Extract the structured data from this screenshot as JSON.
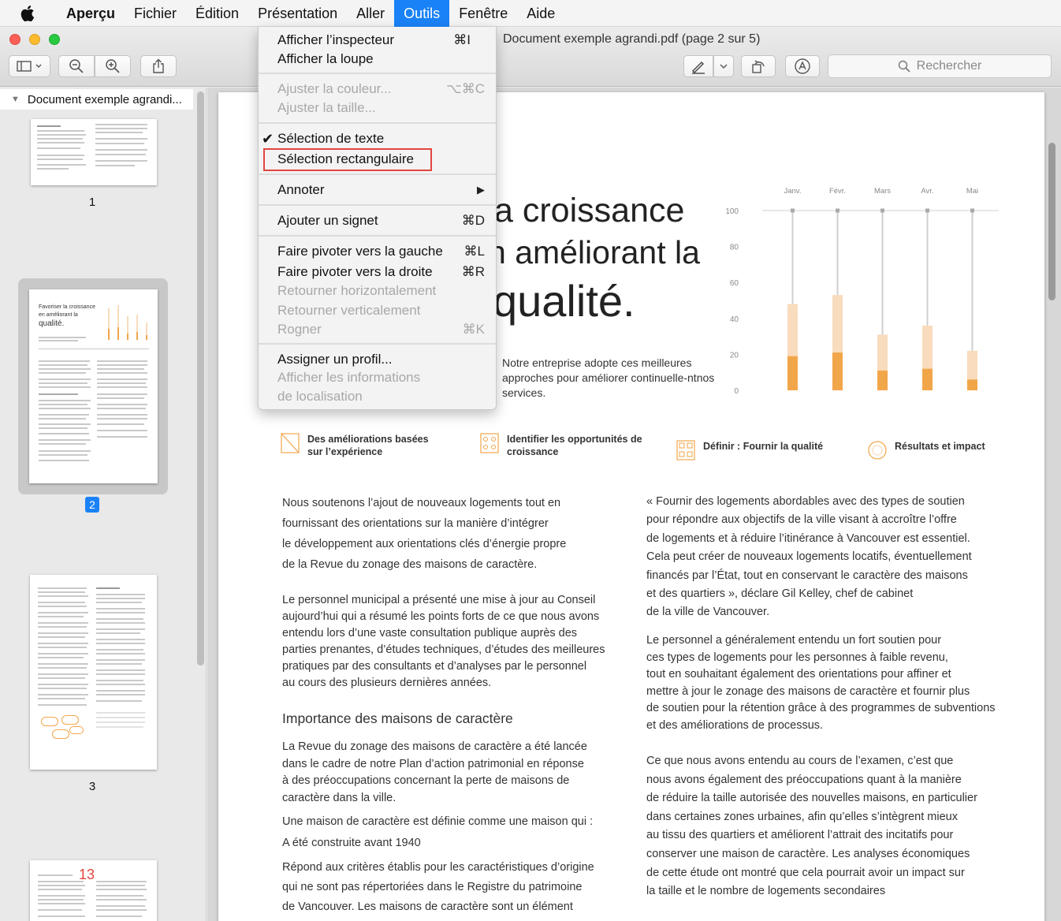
{
  "menubar": {
    "items": [
      "Aperçu",
      "Fichier",
      "Édition",
      "Présentation",
      "Aller",
      "Outils",
      "Fenêtre",
      "Aide"
    ],
    "active": "Outils"
  },
  "window": {
    "title": "Document exemple agrandi.pdf (page 2 sur 5)",
    "search_placeholder": "Rechercher"
  },
  "sidebar": {
    "header": "Document exemple agrandi...",
    "pages": [
      "1",
      "2",
      "3"
    ],
    "thumb2_title": [
      "Favoriser la croissance",
      "en améliorant la",
      "qualité."
    ],
    "thumb4_number": "13"
  },
  "menu": {
    "items": [
      {
        "label": "Afficher l’inspecteur",
        "shortcut": "⌘I",
        "enabled": true
      },
      {
        "label": "Afficher la loupe",
        "shortcut": "",
        "enabled": true
      },
      {
        "label": "Ajuster la couleur...",
        "shortcut": "⌥⌘C",
        "enabled": false
      },
      {
        "label": "Ajuster la taille...",
        "shortcut": "",
        "enabled": false
      },
      {
        "label": "Sélection de texte",
        "shortcut": "",
        "enabled": true,
        "checked": true
      },
      {
        "label": "Sélection rectangulaire",
        "shortcut": "",
        "enabled": true,
        "highlighted": true
      },
      {
        "label": "Annoter",
        "shortcut": "▶",
        "enabled": true
      },
      {
        "label": "Ajouter un signet",
        "shortcut": "⌘D",
        "enabled": true
      },
      {
        "label": "Faire pivoter vers la gauche",
        "shortcut": "⌘L",
        "enabled": true
      },
      {
        "label": "Faire pivoter vers la droite",
        "shortcut": "⌘R",
        "enabled": true
      },
      {
        "label": "Retourner horizontalement",
        "shortcut": "",
        "enabled": false
      },
      {
        "label": "Retourner verticalement",
        "shortcut": "",
        "enabled": false
      },
      {
        "label": "Rogner",
        "shortcut": "⌘K",
        "enabled": false
      },
      {
        "label": "Assigner un profil...",
        "shortcut": "",
        "enabled": true
      },
      {
        "label": "Afficher les informations",
        "shortcut": "",
        "enabled": false
      },
      {
        "label": "de localisation",
        "shortcut": "",
        "enabled": false
      }
    ]
  },
  "document": {
    "headline": [
      "a croissance",
      "n améliorant la",
      "qualité."
    ],
    "intro": "Notre entreprise adopte ces meilleures approches pour améliorer continuelle-ntnos services.",
    "features": [
      {
        "label": "Des améliorations basées sur l’expérience"
      },
      {
        "label": "Identifier les opportunités de croissance"
      },
      {
        "label": "Définir : Fournir la qualité"
      },
      {
        "label": "Résultats et impact"
      }
    ],
    "left_col": {
      "p1": [
        "Nous soutenons l’ajout de nouveaux logements tout en",
        "fournissant des orientations sur la manière d’intégrer",
        "le développement aux orientations clés d’énergie propre",
        "de la Revue du zonage des maisons de caractère."
      ],
      "p2": [
        "Le personnel municipal a présenté une mise à jour au Conseil",
        "aujourd’hui qui a résumé les points forts de ce que nous avons",
        "entendu lors d’une vaste consultation publique auprès des",
        "parties prenantes, d’études techniques, d’études des meilleures",
        "pratiques par des consultants et d’analyses par le personnel",
        "au cours des plusieurs dernières années."
      ],
      "heading": "Importance des maisons de caractère",
      "p3": [
        "La Revue du zonage des maisons de caractère a été lancée",
        "dans le cadre de notre Plan d’action patrimonial en réponse",
        "à des préoccupations concernant la perte de maisons de",
        "caractère dans la ville."
      ],
      "p4": "Une maison de caractère est définie comme une maison qui :",
      "p5": "A été construite avant 1940",
      "p6": [
        "Répond aux critères établis pour les caractéristiques d’origine",
        "qui ne sont pas répertoriées dans le Registre du patrimoine",
        "de Vancouver. Les maisons de caractère sont un élément"
      ]
    },
    "right_col": {
      "p1": [
        "« Fournir des logements abordables avec des types de soutien",
        "pour répondre aux objectifs de la ville visant à accroître l’offre",
        "de logements et à réduire l’itinérance à Vancouver est essentiel.",
        "Cela peut créer de nouveaux logements locatifs, éventuellement",
        "financés par l’État, tout en conservant le caractère des maisons",
        "et des quartiers », déclare Gil Kelley, chef de cabinet",
        "de la ville de Vancouver."
      ],
      "p2": [
        "Le personnel a généralement entendu un fort soutien pour",
        "ces types de logements pour les personnes à faible revenu,",
        "tout en souhaitant également des orientations pour affiner et",
        "mettre à jour le zonage des maisons de caractère et fournir plus",
        "de soutien pour la rétention grâce à des programmes de subventions",
        "et des améliorations de processus."
      ],
      "p3": [
        "Ce que nous avons entendu au cours de l’examen, c’est que",
        "nous avons également des préoccupations quant à la manière",
        "de réduire la taille autorisée des nouvelles maisons, en particulier",
        "dans certaines zones urbaines, afin qu’elles s’intègrent mieux",
        "au tissu des quartiers et améliorent l’attrait des incitatifs pour",
        "conserver une maison de caractère. Les analyses économiques",
        "de cette étude ont montré que cela pourrait avoir un impact sur",
        "la taille et le nombre de logements secondaires"
      ]
    }
  },
  "chart_data": {
    "type": "bar",
    "categories": [
      "Janv.",
      "Févr.",
      "Mars",
      "Avr.",
      "Mai"
    ],
    "ylim": [
      0,
      100
    ],
    "yticks": [
      "0",
      "20",
      "40",
      "60",
      "80",
      "100"
    ],
    "series": [
      {
        "values": [
          48,
          53,
          31,
          36,
          22
        ],
        "color": "#f8dcbd"
      },
      {
        "values": [
          19,
          21,
          11,
          12,
          6
        ],
        "color": "#f2a64a"
      }
    ],
    "markers": [
      100,
      100,
      100,
      100,
      100
    ],
    "colors": {
      "line": "#cfcfcf",
      "axis_text": "#888888"
    }
  }
}
